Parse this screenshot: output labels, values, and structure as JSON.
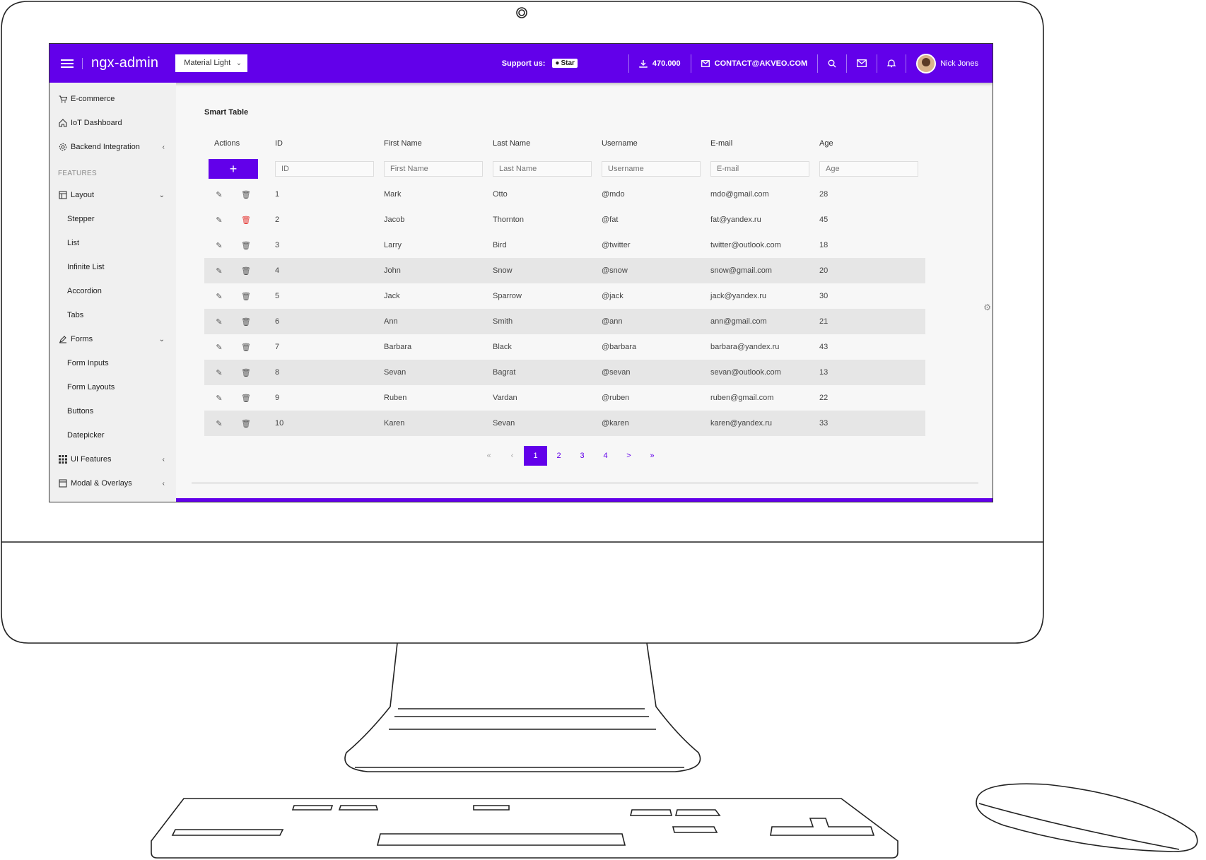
{
  "header": {
    "logo": "ngx-admin",
    "theme": "Material Light",
    "support_label": "Support us:",
    "star_label": "Star",
    "downloads": "470.000",
    "contact": "CONTACT@AKVEO.COM",
    "user_name": "Nick Jones",
    "color": "#6200ea"
  },
  "sidebar": {
    "items": [
      {
        "label": "E-commerce",
        "icon": "shopping-cart-icon"
      },
      {
        "label": "IoT Dashboard",
        "icon": "home-icon"
      },
      {
        "label": "Backend Integration",
        "icon": "gear-icon"
      }
    ],
    "group_label": "FEATURES",
    "layout": {
      "label": "Layout",
      "children": [
        "Stepper",
        "List",
        "Infinite List",
        "Accordion",
        "Tabs"
      ]
    },
    "forms": {
      "label": "Forms",
      "children": [
        "Form Inputs",
        "Form Layouts",
        "Buttons",
        "Datepicker"
      ]
    },
    "ui_features": "UI Features",
    "modal": "Modal & Overlays"
  },
  "table": {
    "title": "Smart Table",
    "columns": [
      "Actions",
      "ID",
      "First Name",
      "Last Name",
      "Username",
      "E-mail",
      "Age"
    ],
    "filters": [
      "ID",
      "First Name",
      "Last Name",
      "Username",
      "E-mail",
      "Age"
    ],
    "add_label": "+",
    "rows": [
      [
        "1",
        "Mark",
        "Otto",
        "@mdo",
        "mdo@gmail.com",
        "28"
      ],
      [
        "2",
        "Jacob",
        "Thornton",
        "@fat",
        "fat@yandex.ru",
        "45"
      ],
      [
        "3",
        "Larry",
        "Bird",
        "@twitter",
        "twitter@outlook.com",
        "18"
      ],
      [
        "4",
        "John",
        "Snow",
        "@snow",
        "snow@gmail.com",
        "20"
      ],
      [
        "5",
        "Jack",
        "Sparrow",
        "@jack",
        "jack@yandex.ru",
        "30"
      ],
      [
        "6",
        "Ann",
        "Smith",
        "@ann",
        "ann@gmail.com",
        "21"
      ],
      [
        "7",
        "Barbara",
        "Black",
        "@barbara",
        "barbara@yandex.ru",
        "43"
      ],
      [
        "8",
        "Sevan",
        "Bagrat",
        "@sevan",
        "sevan@outlook.com",
        "13"
      ],
      [
        "9",
        "Ruben",
        "Vardan",
        "@ruben",
        "ruben@gmail.com",
        "22"
      ],
      [
        "10",
        "Karen",
        "Sevan",
        "@karen",
        "karen@yandex.ru",
        "33"
      ]
    ]
  },
  "pager": {
    "first": "«",
    "prev": "‹",
    "pages": [
      "1",
      "2",
      "3",
      "4"
    ],
    "next": ">",
    "last": "»",
    "active": "1"
  }
}
